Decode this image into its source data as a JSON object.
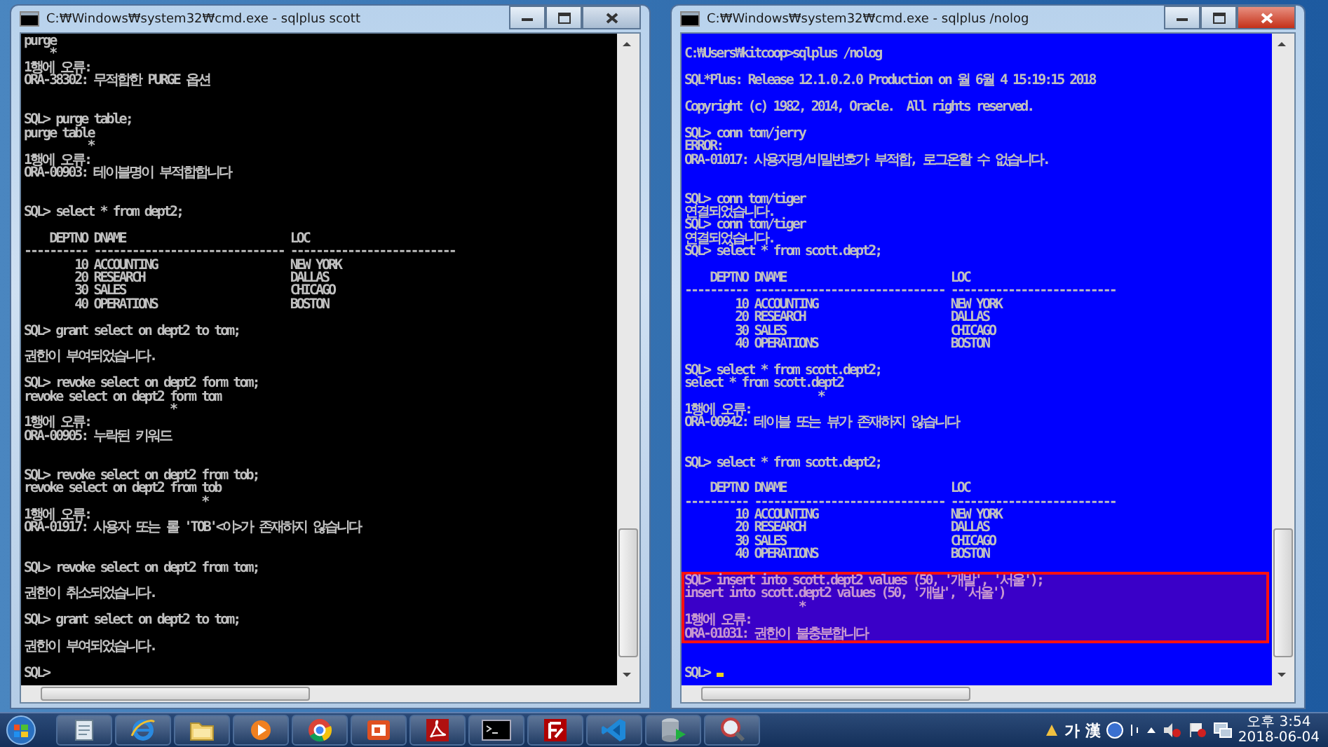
{
  "windows": [
    {
      "title": "C:₩Windows₩system32₩cmd.exe - sqlplus  scott",
      "active": false,
      "color": "#000000",
      "lines": [
        {
          "kind": "text",
          "text": "purge"
        },
        {
          "kind": "text",
          "text": "    *"
        },
        {
          "kind": "text",
          "text": "1행에 오류:"
        },
        {
          "kind": "text",
          "text": "ORA-38302: 무적합한 PURGE 옵션"
        },
        {
          "kind": "blank"
        },
        {
          "kind": "blank"
        },
        {
          "kind": "text",
          "text": "SQL> purge table;"
        },
        {
          "kind": "text",
          "text": "purge table"
        },
        {
          "kind": "text",
          "text": "          *"
        },
        {
          "kind": "text",
          "text": "1행에 오류:"
        },
        {
          "kind": "text",
          "text": "ORA-00903: 테이블명이 부적합합니다"
        },
        {
          "kind": "blank"
        },
        {
          "kind": "blank"
        },
        {
          "kind": "text",
          "text": "SQL> select * from dept2;"
        },
        {
          "kind": "blank"
        },
        {
          "kind": "text",
          "text": "    DEPTNO DNAME                          LOC"
        },
        {
          "kind": "text",
          "text": "---------- ------------------------------ --------------------------"
        },
        {
          "kind": "text",
          "text": "        10 ACCOUNTING                     NEW YORK"
        },
        {
          "kind": "text",
          "text": "        20 RESEARCH                       DALLAS"
        },
        {
          "kind": "text",
          "text": "        30 SALES                          CHICAGO"
        },
        {
          "kind": "text",
          "text": "        40 OPERATIONS                     BOSTON"
        },
        {
          "kind": "blank"
        },
        {
          "kind": "text",
          "text": "SQL> grant select on dept2 to tom;"
        },
        {
          "kind": "blank"
        },
        {
          "kind": "text",
          "text": "권한이 부여되었습니다."
        },
        {
          "kind": "blank"
        },
        {
          "kind": "text",
          "text": "SQL> revoke select on dept2 form tom;"
        },
        {
          "kind": "text",
          "text": "revoke select on dept2 form tom"
        },
        {
          "kind": "text",
          "text": "                       *"
        },
        {
          "kind": "text",
          "text": "1행에 오류:"
        },
        {
          "kind": "text",
          "text": "ORA-00905: 누락된 키워드"
        },
        {
          "kind": "blank"
        },
        {
          "kind": "blank"
        },
        {
          "kind": "text",
          "text": "SQL> revoke select on dept2 from tob;"
        },
        {
          "kind": "text",
          "text": "revoke select on dept2 from tob"
        },
        {
          "kind": "text",
          "text": "                            *"
        },
        {
          "kind": "text",
          "text": "1행에 오류:"
        },
        {
          "kind": "text",
          "text": "ORA-01917: 사용자 또는 롤 'TOB'<이>가 존재하지 않습니다"
        },
        {
          "kind": "blank"
        },
        {
          "kind": "blank"
        },
        {
          "kind": "text",
          "text": "SQL> revoke select on dept2 from tom;"
        },
        {
          "kind": "blank"
        },
        {
          "kind": "text",
          "text": "권한이 취소되었습니다."
        },
        {
          "kind": "blank"
        },
        {
          "kind": "text",
          "text": "SQL> grant select on dept2 to tom;"
        },
        {
          "kind": "blank"
        },
        {
          "kind": "text",
          "text": "권한이 부여되었습니다."
        },
        {
          "kind": "blank"
        },
        {
          "kind": "text",
          "text": "SQL>"
        }
      ]
    },
    {
      "title": "C:₩Windows₩system32₩cmd.exe - sqlplus  /nolog",
      "active": true,
      "color": "#0000ff",
      "lines": [
        {
          "kind": "blank"
        },
        {
          "kind": "text",
          "text": "C:₩Users₩kitcoop>sqlplus /nolog"
        },
        {
          "kind": "blank"
        },
        {
          "kind": "text",
          "text": "SQL*Plus: Release 12.1.0.2.0 Production on 월 6월 4 15:19:15 2018"
        },
        {
          "kind": "blank"
        },
        {
          "kind": "text",
          "text": "Copyright (c) 1982, 2014, Oracle.  All rights reserved."
        },
        {
          "kind": "blank"
        },
        {
          "kind": "text",
          "text": "SQL> conn tom/jerry"
        },
        {
          "kind": "text",
          "text": "ERROR:"
        },
        {
          "kind": "text",
          "text": "ORA-01017: 사용자명/비밀번호가 부적합, 로그온할 수 없습니다."
        },
        {
          "kind": "blank"
        },
        {
          "kind": "blank"
        },
        {
          "kind": "text",
          "text": "SQL> conn tom/tiger"
        },
        {
          "kind": "text",
          "text": "연결되었습니다."
        },
        {
          "kind": "text",
          "text": "SQL> conn tom/tiger"
        },
        {
          "kind": "text",
          "text": "연결되었습니다."
        },
        {
          "kind": "text",
          "text": "SQL> select * from scott.dept2;"
        },
        {
          "kind": "blank"
        },
        {
          "kind": "text",
          "text": "    DEPTNO DNAME                          LOC"
        },
        {
          "kind": "text",
          "text": "---------- ------------------------------ --------------------------"
        },
        {
          "kind": "text",
          "text": "        10 ACCOUNTING                     NEW YORK"
        },
        {
          "kind": "text",
          "text": "        20 RESEARCH                       DALLAS"
        },
        {
          "kind": "text",
          "text": "        30 SALES                          CHICAGO"
        },
        {
          "kind": "text",
          "text": "        40 OPERATIONS                     BOSTON"
        },
        {
          "kind": "blank"
        },
        {
          "kind": "text",
          "text": "SQL> select * from scott.dept2;"
        },
        {
          "kind": "text",
          "text": "select * from scott.dept2"
        },
        {
          "kind": "text",
          "text": "                     *"
        },
        {
          "kind": "text",
          "text": "1행에 오류:"
        },
        {
          "kind": "text",
          "text": "ORA-00942: 테이블 또는 뷰가 존재하지 않습니다"
        },
        {
          "kind": "blank"
        },
        {
          "kind": "blank"
        },
        {
          "kind": "text",
          "text": "SQL> select * from scott.dept2;"
        },
        {
          "kind": "blank"
        },
        {
          "kind": "text",
          "text": "    DEPTNO DNAME                          LOC"
        },
        {
          "kind": "text",
          "text": "---------- ------------------------------ --------------------------"
        },
        {
          "kind": "text",
          "text": "        10 ACCOUNTING                     NEW YORK"
        },
        {
          "kind": "text",
          "text": "        20 RESEARCH                       DALLAS"
        },
        {
          "kind": "text",
          "text": "        30 SALES                          CHICAGO"
        },
        {
          "kind": "text",
          "text": "        40 OPERATIONS                     BOSTON"
        },
        {
          "kind": "blank"
        },
        {
          "kind": "highlight",
          "text": "SQL> insert into scott.dept2 values (50, '개발', '서울');"
        },
        {
          "kind": "highlight",
          "text": "insert into scott.dept2 values (50, '개발', '서울')"
        },
        {
          "kind": "highlight",
          "text": "                  *"
        },
        {
          "kind": "highlight",
          "text": "1행에 오류:"
        },
        {
          "kind": "highlight",
          "text": "ORA-01031: 권한이 불충분합니다"
        },
        {
          "kind": "blank"
        },
        {
          "kind": "blank"
        },
        {
          "kind": "text",
          "text": "SQL>",
          "cursor": true
        }
      ]
    }
  ],
  "taskbar": {
    "apps": [
      {
        "kind": "notepad"
      },
      {
        "kind": "browser"
      },
      {
        "kind": "folder"
      },
      {
        "kind": "media"
      },
      {
        "kind": "chrome"
      },
      {
        "kind": "slides"
      },
      {
        "kind": "pdf"
      },
      {
        "kind": "terminal"
      },
      {
        "kind": "ftp"
      },
      {
        "kind": "code"
      },
      {
        "kind": "database"
      },
      {
        "kind": "tool"
      }
    ],
    "ime": [
      "가",
      "漢"
    ],
    "clock": {
      "time": "오후 3:54",
      "date": "2018-06-04"
    }
  }
}
